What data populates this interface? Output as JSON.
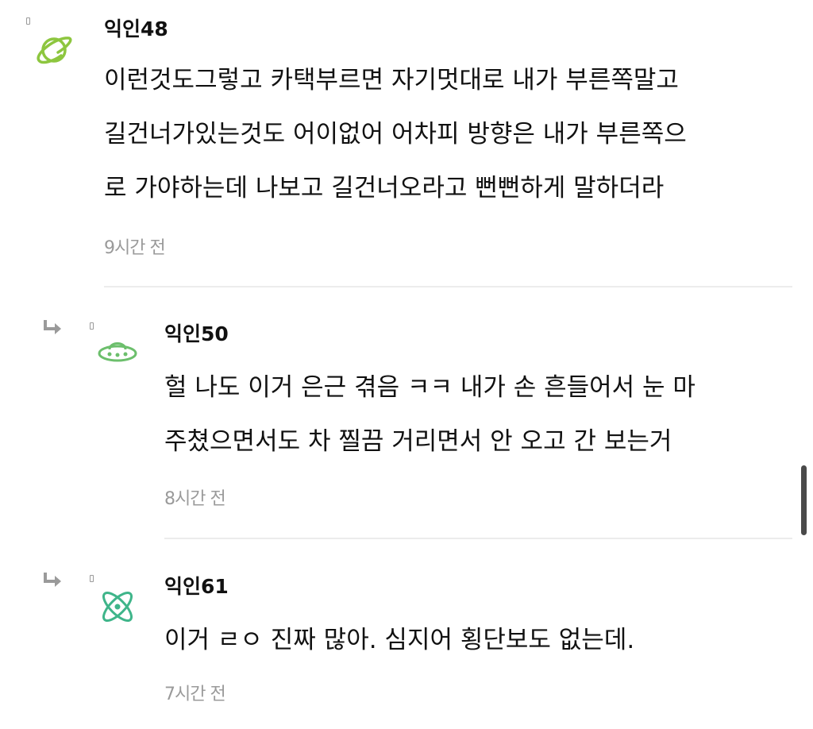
{
  "comments": [
    {
      "author": "익인48",
      "avatar_icon": "planet-icon",
      "avatar_color": "#8dc63f",
      "body": "이런것도그렇고 카택부르면 자기멋대로 내가 부른쪽말고\n길건너가있는것도 어이없어 어차피 방향은 내가 부른쪽으\n로 가야하는데 나보고 길건너오라고 뻔뻔하게 말하더라",
      "time": "9시간 전"
    },
    {
      "author": "익인50",
      "avatar_icon": "ufo-icon",
      "avatar_color": "#6cbf6c",
      "reply": true,
      "body": "헐 나도 이거 은근 겪음 ㅋㅋ 내가 손 흔들어서 눈 마\n주쳤으면서도 차 찔끔 거리면서 안 오고 간 보는거",
      "time": "8시간 전"
    },
    {
      "author": "익인61",
      "avatar_icon": "atom-icon",
      "avatar_color": "#3fb58a",
      "reply": true,
      "body": "이거 ㄹㅇ 진짜 많아. 심지어 횡단보도 없는데.",
      "time": "7시간 전"
    }
  ],
  "icons": {
    "reply_arrow": "reply-arrow-icon",
    "menu_box": "small-box-icon"
  },
  "colors": {
    "text": "#111111",
    "timestamp": "#9a9a9a",
    "divider": "#ececec",
    "reply_arrow": "#9a9a9a"
  }
}
